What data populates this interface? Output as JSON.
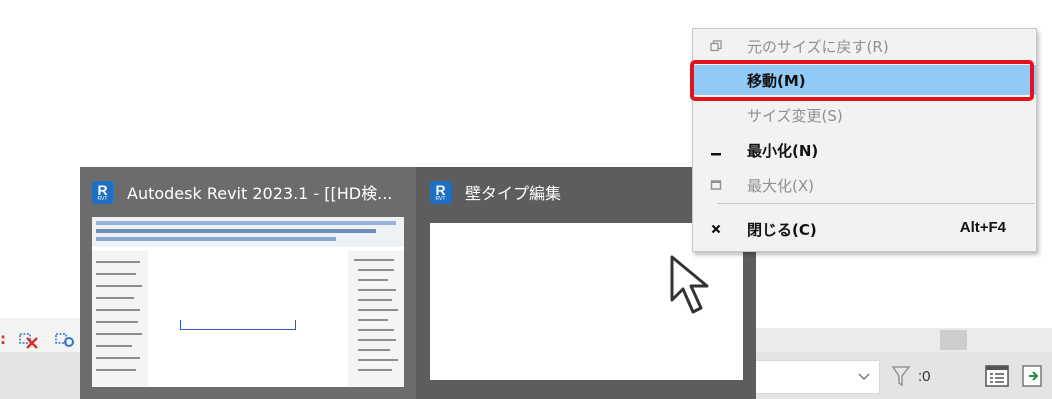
{
  "background": {
    "filter_count": ":0"
  },
  "taskbar_preview": {
    "windows": [
      {
        "title": "Autodesk Revit 2023.1 - [[HD検...",
        "icon_letter": "R",
        "icon_sub": "RVT"
      },
      {
        "title": "壁タイプ編集",
        "icon_letter": "R",
        "icon_sub": "RVT"
      }
    ]
  },
  "context_menu": {
    "items": [
      {
        "label": "元のサイズに戻す(R)",
        "icon": "restore-icon",
        "enabled": false
      },
      {
        "label": "移動(M)",
        "icon": "",
        "enabled": true,
        "highlighted": true
      },
      {
        "label": "サイズ変更(S)",
        "icon": "",
        "enabled": false
      },
      {
        "label": "最小化(N)",
        "icon": "minimize-icon",
        "enabled": true
      },
      {
        "label": "最大化(X)",
        "icon": "maximize-icon",
        "enabled": false
      },
      {
        "label": "閉じる(C)",
        "icon": "close-icon",
        "enabled": true,
        "shortcut": "Alt+F4"
      }
    ]
  },
  "colors": {
    "highlight": "#91c9f7",
    "annotation_frame": "#e3121b",
    "preview_bg": "#5d5d5d",
    "revit_blue": "#1f6fc5"
  }
}
